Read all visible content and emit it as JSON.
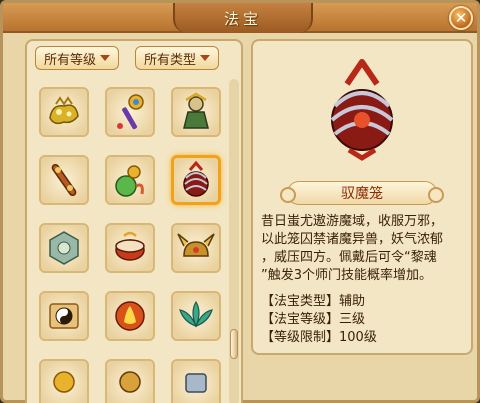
{
  "window": {
    "title": "法宝",
    "close_label": "✕"
  },
  "filters": {
    "level": {
      "label": "所有等级"
    },
    "type": {
      "label": "所有类型"
    }
  },
  "items": [
    {
      "icon": "golden-ornament-icon"
    },
    {
      "icon": "jeweled-scepter-icon"
    },
    {
      "icon": "warrior-figure-icon"
    },
    {
      "icon": "carved-flute-icon"
    },
    {
      "icon": "snake-gourd-icon"
    },
    {
      "icon": "demon-cage-icon",
      "selected": true
    },
    {
      "icon": "jade-seal-icon"
    },
    {
      "icon": "drum-icon"
    },
    {
      "icon": "horned-helmet-icon"
    },
    {
      "icon": "yin-yang-scroll-icon"
    },
    {
      "icon": "fire-orb-icon"
    },
    {
      "icon": "lotus-icon"
    },
    {
      "icon": "partial-item-icon"
    },
    {
      "icon": "partial-item-icon"
    },
    {
      "icon": "partial-item-icon"
    }
  ],
  "detail": {
    "name": "驭魔笼",
    "description_lines": [
      "昔日蚩尤遨游魔域，收服万邪，",
      "以此笼囚禁诸魔异兽，妖气浓郁",
      "，威压四方。佩戴后可令“黎魂",
      "”触发3个师门技能概率增加。"
    ],
    "attributes": [
      {
        "label": "【法宝类型】",
        "value": "辅助"
      },
      {
        "label": "【法宝等级】",
        "value": "三级"
      },
      {
        "label": "【等级限制】",
        "value": "100级"
      }
    ]
  },
  "colors": {
    "accent": "#b8732f",
    "panel": "#f3e6c4",
    "selected_border": "#f2a21a",
    "name_color": "#8a2f08"
  }
}
